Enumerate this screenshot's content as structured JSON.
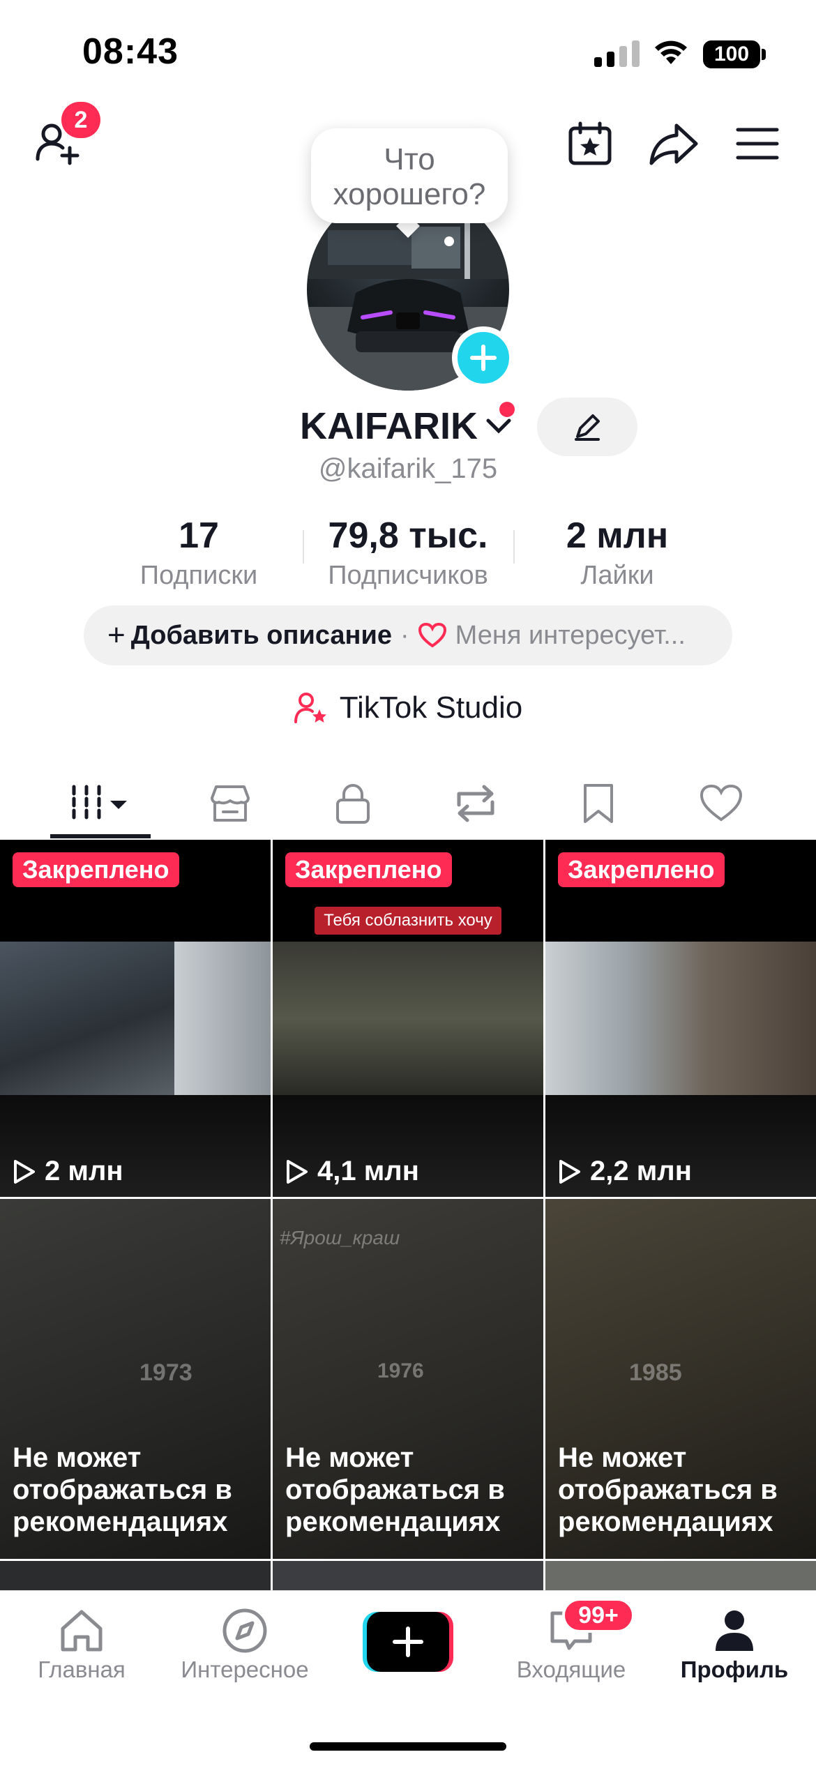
{
  "status_bar": {
    "time": "08:43",
    "battery": "100"
  },
  "header": {
    "friend_requests_badge": "2"
  },
  "bubble": {
    "text": "Что хорошего?"
  },
  "profile": {
    "display_name": "KAIFARIK",
    "handle": "@kaifarik_175"
  },
  "stats": [
    {
      "value": "17",
      "label": "Подписки"
    },
    {
      "value": "79,8 тыс.",
      "label": "Подписчиков"
    },
    {
      "value": "2 млн",
      "label": "Лайки"
    }
  ],
  "description": {
    "add_label": "Добавить описание",
    "separator": "·",
    "interests_label": "Меня интересует..."
  },
  "studio": {
    "label": "TikTok Studio"
  },
  "tabs": [
    "videos",
    "showcase",
    "private",
    "reposts",
    "favorites",
    "liked"
  ],
  "videos": [
    {
      "pinned_label": "Закреплено",
      "views": "2 млн"
    },
    {
      "pinned_label": "Закреплено",
      "views": "4,1 млн",
      "caption": "Тебя соблазнить хочу"
    },
    {
      "pinned_label": "Закреплено",
      "views": "2,2 млн"
    },
    {
      "warning": "Не может отображаться в рекомендациях",
      "year": "1973"
    },
    {
      "warning": "Не может отображаться в рекомендациях",
      "hashtag": "#Ярош_краш",
      "year": "1976"
    },
    {
      "warning": "Не может отображаться в рекомендациях",
      "year": "1985"
    }
  ],
  "nav": {
    "home": "Главная",
    "explore": "Интересное",
    "inbox": "Входящие",
    "inbox_badge": "99+",
    "profile": "Профиль"
  },
  "colors": {
    "accent": "#fe2c55",
    "cyan": "#20d5ec",
    "text": "#161823",
    "muted": "#8a8b91"
  }
}
